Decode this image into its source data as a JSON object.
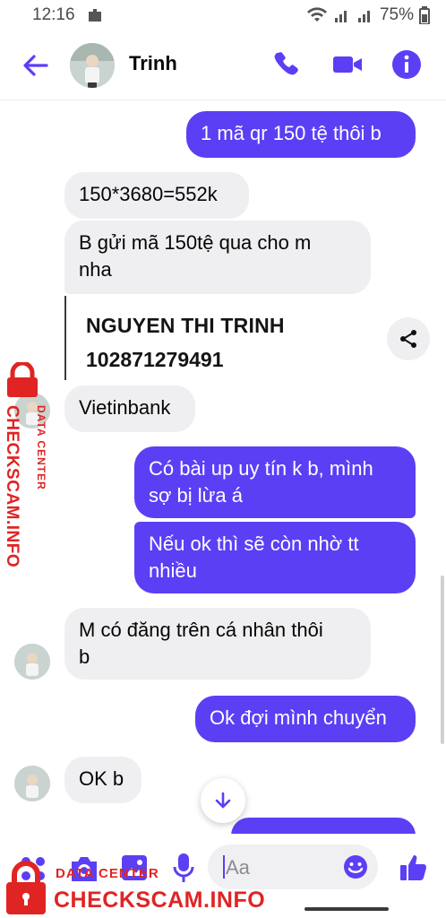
{
  "status_bar": {
    "time": "12:16",
    "battery": "75%"
  },
  "header": {
    "contact_name": "Trinh"
  },
  "messages": [
    {
      "dir": "out",
      "text": "1 mã qr 150 tệ thôi b"
    },
    {
      "dir": "in",
      "text": "150*3680=552k"
    },
    {
      "dir": "in",
      "text": "B gửi mã 150tệ qua cho m\nnha"
    },
    {
      "dir": "in",
      "type": "image",
      "lines": [
        "NGUYEN THI TRINH",
        "102871279491"
      ]
    },
    {
      "dir": "in",
      "text": "Vietinbank"
    },
    {
      "dir": "out",
      "text": "Có bài up uy tín k b, mình\nsợ bị lừa á"
    },
    {
      "dir": "out",
      "text": "Nếu ok thì sẽ còn nhờ tt\nnhiều"
    },
    {
      "dir": "in",
      "text": "M có đăng trên cá nhân thôi\nb"
    },
    {
      "dir": "out",
      "text": "Ok đợi mình chuyển"
    },
    {
      "dir": "in",
      "text": "OK b"
    }
  ],
  "composer": {
    "placeholder": "Aa"
  },
  "watermark": {
    "small": "DATA CENTER",
    "big": "CHECKSCAM.INFO"
  },
  "colors": {
    "accent": "#5b3ff5",
    "incoming": "#efeff1",
    "watermark": "#e02424"
  },
  "icons": [
    "back-arrow-icon",
    "phone-icon",
    "video-icon",
    "info-icon",
    "share-icon",
    "arrow-down-icon",
    "camera-icon",
    "image-icon",
    "microphone-icon",
    "emoji-icon",
    "like-icon",
    "apps-icon",
    "lock-icon"
  ]
}
